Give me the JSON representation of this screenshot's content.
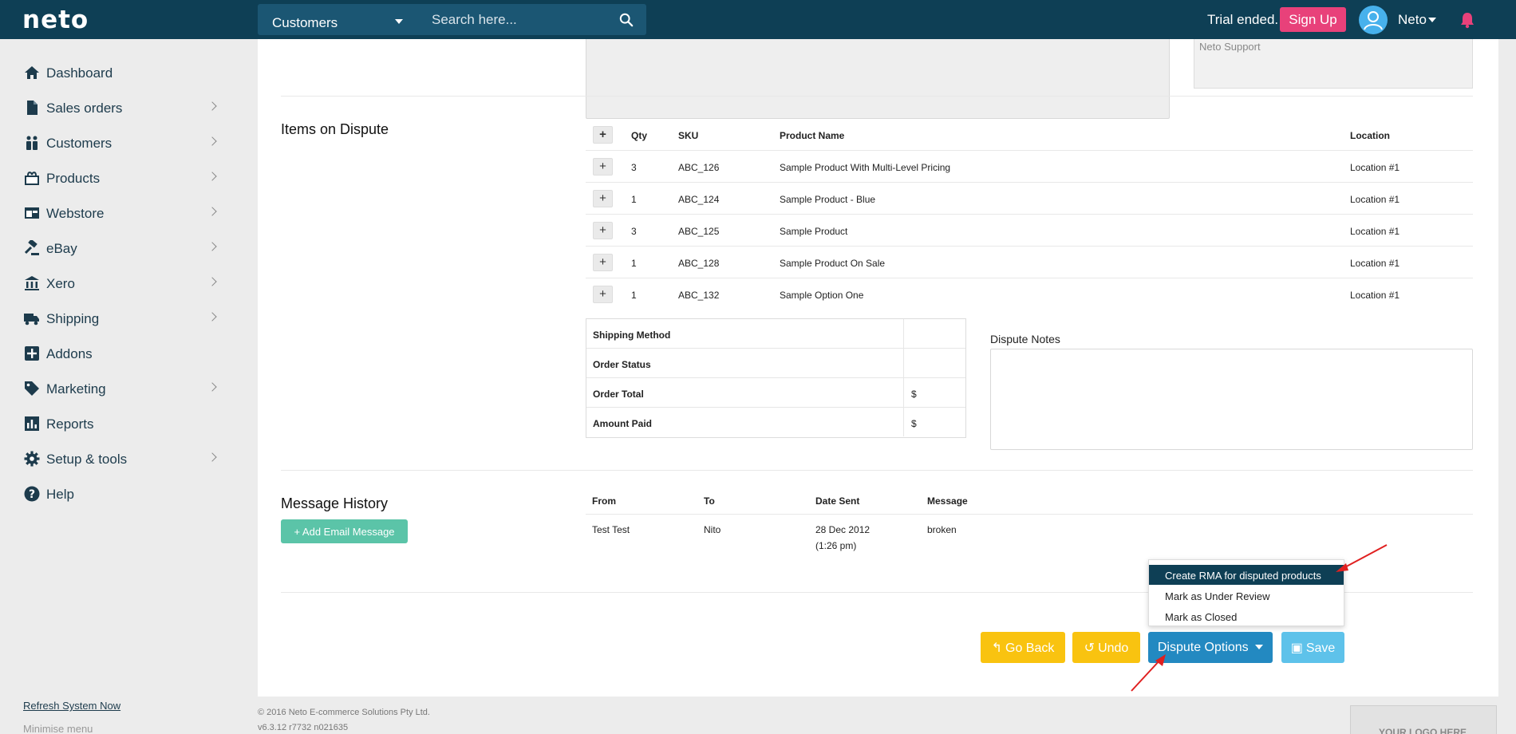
{
  "topbar": {
    "logo": "neto",
    "category": "Customers",
    "search_placeholder": "Search here...",
    "trial_text": "Trial ended.",
    "signup_label": "Sign Up",
    "user_name": "Neto"
  },
  "sidebar": {
    "items": [
      {
        "label": "Dashboard",
        "icon": "home-icon",
        "chevron": false
      },
      {
        "label": "Sales orders",
        "icon": "document-icon",
        "chevron": true
      },
      {
        "label": "Customers",
        "icon": "people-icon",
        "chevron": true
      },
      {
        "label": "Products",
        "icon": "box-icon",
        "chevron": true
      },
      {
        "label": "Webstore",
        "icon": "browser-icon",
        "chevron": true
      },
      {
        "label": "eBay",
        "icon": "gavel-icon",
        "chevron": true
      },
      {
        "label": "Xero",
        "icon": "bank-icon",
        "chevron": true
      },
      {
        "label": "Shipping",
        "icon": "truck-icon",
        "chevron": true
      },
      {
        "label": "Addons",
        "icon": "plus-square-icon",
        "chevron": false
      },
      {
        "label": "Marketing",
        "icon": "tag-icon",
        "chevron": true
      },
      {
        "label": "Reports",
        "icon": "bar-chart-icon",
        "chevron": false
      },
      {
        "label": "Setup & tools",
        "icon": "gear-icon",
        "chevron": true
      },
      {
        "label": "Help",
        "icon": "question-icon",
        "chevron": false
      }
    ],
    "refresh_label": "Refresh System Now",
    "minimise_label": "Minimise menu"
  },
  "main": {
    "support_value": "Neto Support",
    "items_title": "Items on Dispute",
    "items_columns": [
      "Qty",
      "SKU",
      "Product Name",
      "Location"
    ],
    "items": [
      {
        "qty": "3",
        "sku": "ABC_126",
        "name": "Sample Product With Multi-Level Pricing",
        "location": "Location #1"
      },
      {
        "qty": "1",
        "sku": "ABC_124",
        "name": "Sample Product - Blue",
        "location": "Location #1"
      },
      {
        "qty": "3",
        "sku": "ABC_125",
        "name": "Sample Product",
        "location": "Location #1"
      },
      {
        "qty": "1",
        "sku": "ABC_128",
        "name": "Sample Product On Sale",
        "location": "Location #1"
      },
      {
        "qty": "1",
        "sku": "ABC_132",
        "name": "Sample Option One",
        "location": "Location #1"
      }
    ],
    "summary": [
      {
        "label": "Shipping Method",
        "value": ""
      },
      {
        "label": "Order Status",
        "value": ""
      },
      {
        "label": "Order Total",
        "value": "$"
      },
      {
        "label": "Amount Paid",
        "value": "$"
      }
    ],
    "notes_label": "Dispute Notes",
    "message_title": "Message History",
    "add_email_label": "+ Add Email Message",
    "message_columns": [
      "From",
      "To",
      "Date Sent",
      "Message"
    ],
    "messages": [
      {
        "from": "Test Test",
        "to": "Nito",
        "date_line1": "28 Dec 2012",
        "date_line2": "(1:26 pm)",
        "message": "broken"
      }
    ]
  },
  "dropdown": {
    "items": [
      "Create RMA for disputed products",
      "Mark as Under Review",
      "Mark as Closed"
    ]
  },
  "actions": {
    "go_back": "Go Back",
    "undo": "Undo",
    "dispute_options": "Dispute Options",
    "save": "Save"
  },
  "footer": {
    "copyright": "© 2016 Neto E-commerce Solutions Pty Ltd.",
    "version": "v6.3.12 r7732 n021635",
    "logo_placeholder": "YOUR LOGO HERE"
  },
  "colors": {
    "topbar": "#0e3f55",
    "signup": "#e8417a",
    "warning": "#f9c310",
    "primary": "#2389c1",
    "info": "#5ec2ea",
    "success": "#5bc4a8",
    "annotation": "#e02020"
  }
}
